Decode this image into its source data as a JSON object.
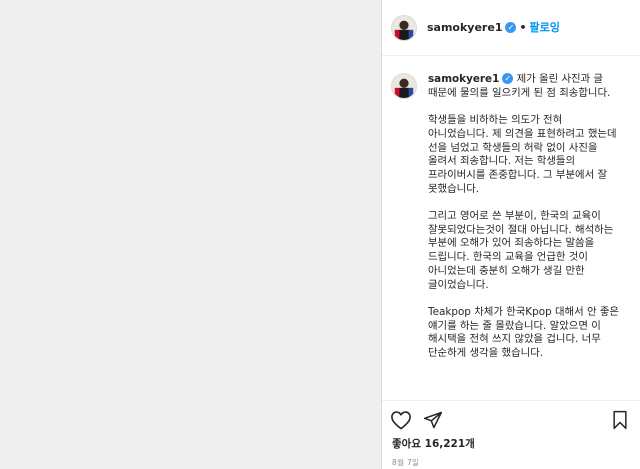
{
  "post": {
    "username": "samokyere1",
    "follow_label": "팔로잉",
    "caption": {
      "username": "samokyere1",
      "paragraphs": [
        "제가 올린 사진과 글 때문에 물의를 일으키게 된 점 죄송합니다.",
        "학생들을 비하하는 의도가 전혀 아니었습니다. 제 의견을 표현하려고 했는데 선을 넘었고 학생들의 허락 없이 사진을 올려서 죄송합니다. 저는 학생들의 프라이버시를 존중합니다. 그 부분에서 잘 못했습니다.",
        "그리고 영어로 쓴 부분이, 한국의 교육이 잘못되었다는것이 절대 아닙니다. 해석하는 부분에 오해가 있어 죄송하다는 말씀을 드립니다. 한국의 교육을 언급한 것이 아니었는데 충분히 오해가 생길 만한 글이었습니다.",
        "Teakpop 차체가 한국Kpop 대해서 안 좋은 얘기를 하는 줄 몰랐습니다. 알았으면 이 해시택을 전혀 쓰지 않았을 겁니다. 너무 단순하게 생각을 했습니다."
      ]
    },
    "likes_label": "좋아요 16,221개",
    "date": "8월 7일"
  },
  "icons": {
    "verified": "verified-badge-icon",
    "like": "heart-icon",
    "share": "paper-plane-icon",
    "save": "bookmark-icon"
  },
  "colors": {
    "accent": "#0095f6",
    "verified": "#3897f0",
    "text": "#262626",
    "muted": "#8e8e8e"
  }
}
